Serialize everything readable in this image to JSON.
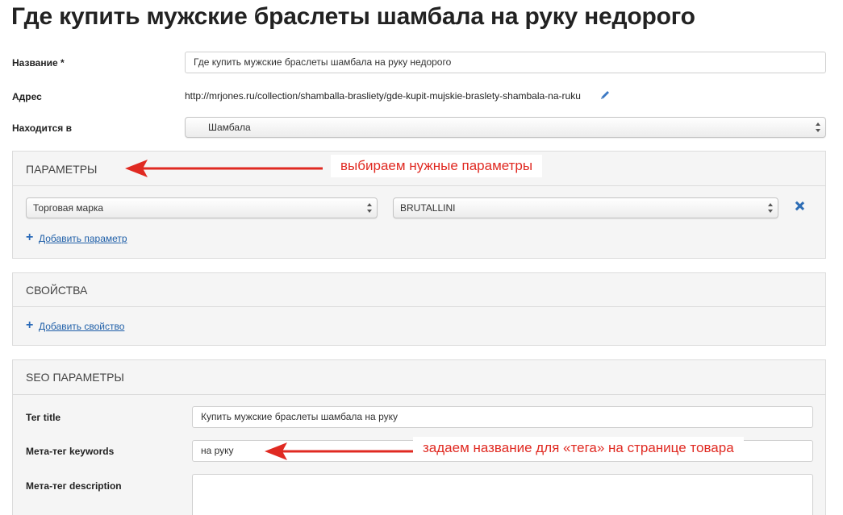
{
  "page": {
    "title": "Где купить мужские браслеты шамбала на руку недорого"
  },
  "form": {
    "name_label": "Название *",
    "name_value": "Где купить мужские браслеты шамбала на руку недорого",
    "address_label": "Адрес",
    "address_value": "http://mrjones.ru/collection/shamballa-brasliety/gde-kupit-mujskie-braslety-shambala-na-ruku",
    "located_label": "Находится в",
    "located_value": "Шамбала"
  },
  "params_panel": {
    "title": "ПАРАМЕТРЫ",
    "param_name": "Торговая марка",
    "param_value": "BRUTALLINI",
    "add_label": "Добавить параметр"
  },
  "props_panel": {
    "title": "СВОЙСТВА",
    "add_label": "Добавить свойство"
  },
  "seo_panel": {
    "title": "SEO ПАРАМЕТРЫ",
    "title_tag_label": "Тег title",
    "title_tag_value": "Купить мужские браслеты шамбала на руку",
    "keywords_label": "Мета-тег keywords",
    "keywords_value": "на руку",
    "description_label": "Мета-тег description",
    "description_value": ""
  },
  "annotations": {
    "params_note": "выбираем нужные параметры",
    "keywords_note": "задаем название для «тега» на странице товара",
    "color": "#e02a22"
  },
  "icons": {
    "edit": "pencil-icon",
    "remove": "close-icon",
    "add": "plus-icon"
  },
  "colors": {
    "link": "#1f5fa8",
    "panel_bg": "#f5f5f5",
    "panel_border": "#dcdcdc"
  }
}
